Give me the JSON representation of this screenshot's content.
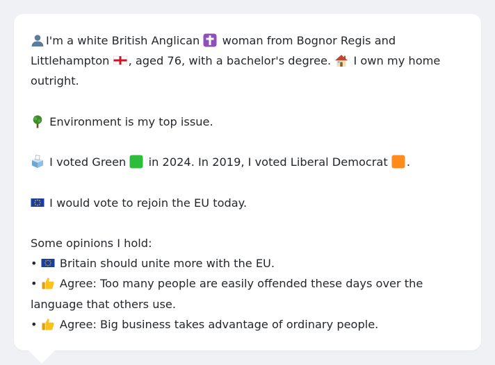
{
  "intro": {
    "part1": "I'm a white British Anglican",
    "part2": "woman from Bognor Regis and Littlehampton",
    "part3": ", aged 76, with a bachelor's degree.",
    "part4": "I own my home outright."
  },
  "issue": {
    "text": "Environment is my top issue."
  },
  "vote": {
    "part1": "I voted Green",
    "part2": "in 2024. In 2019, I voted Liberal Democrat",
    "part3": "."
  },
  "eu": {
    "text": "I would vote to rejoin the EU today."
  },
  "opinions": {
    "heading": "Some opinions I hold:",
    "bullet_char": "•",
    "items": [
      {
        "icon": "eu-flag-icon",
        "text": "Britain should unite more with the EU."
      },
      {
        "icon": "thumbs-up-icon",
        "text": "Agree: Too many people are easily offended these days over the language that others use."
      },
      {
        "icon": "thumbs-up-icon",
        "text": "Agree: Big business takes advantage of ordinary people."
      }
    ]
  },
  "icons": {
    "person": "person-silhouette-icon",
    "religion": "latin-cross-icon",
    "region": "england-flag-icon",
    "home": "house-icon",
    "issue": "tree-icon",
    "ballot": "ballot-box-icon",
    "green_party": "green-square-icon",
    "libdem": "orange-square-icon",
    "eu": "eu-flag-icon",
    "agree": "thumbs-up-icon"
  },
  "colors": {
    "background": "#eff1f4",
    "bubble": "#ffffff",
    "text": "#24272b",
    "green_party": "#2cbe3a",
    "libdem": "#ff8c1a",
    "eu_blue": "#1a3ea0",
    "cross_purple": "#8e4fb8"
  }
}
